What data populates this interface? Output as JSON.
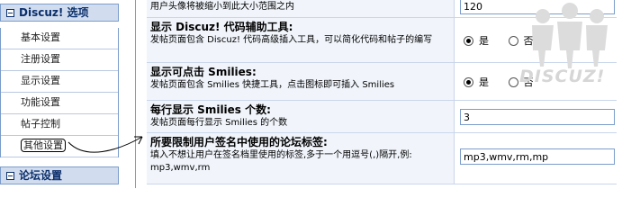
{
  "sidebar": {
    "header1": "Discuz! 选项",
    "items": [
      {
        "label": "基本设置"
      },
      {
        "label": "注册设置"
      },
      {
        "label": "显示设置"
      },
      {
        "label": "功能设置"
      },
      {
        "label": "帖子控制"
      },
      {
        "label": "其他设置",
        "active": true
      }
    ],
    "header2": "论坛设置"
  },
  "main": {
    "rows": [
      {
        "desc": "用户头像将被缩小到此大小范围之内",
        "value": "120"
      },
      {
        "title": "显示 Discuz! 代码辅助工具:",
        "desc": "发帖页面包含 Discuz! 代码高级插入工具，可以简化代码和帖子的编写",
        "yes": "是",
        "no": "否",
        "selected": "yes"
      },
      {
        "title": "显示可点击 Smilies:",
        "desc": "发帖页面包含 Smilies 快捷工具，点击图标即可插入 Smilies",
        "yes": "是",
        "no": "否",
        "selected": "yes"
      },
      {
        "title": "每行显示 Smilies 个数:",
        "desc": "发帖页面每行显示 Smilies 的个数",
        "value": "3"
      },
      {
        "title": "所要限制用户签名中使用的论坛标签:",
        "desc": "填入不想让用户在签名档里使用的标签,多于一个用逗号(,)隔开,例: mp3,wmv,rm",
        "value": "mp3,wmv,rm,mp"
      }
    ]
  },
  "watermark": {
    "text": "DISCUZ!",
    "icon": "people-logo-icon",
    "color": "#d6d6d6"
  },
  "colors": {
    "sidebar_header": "#d1ddef",
    "border": "#7a9cca",
    "label_bg": "#f1f5fb"
  }
}
